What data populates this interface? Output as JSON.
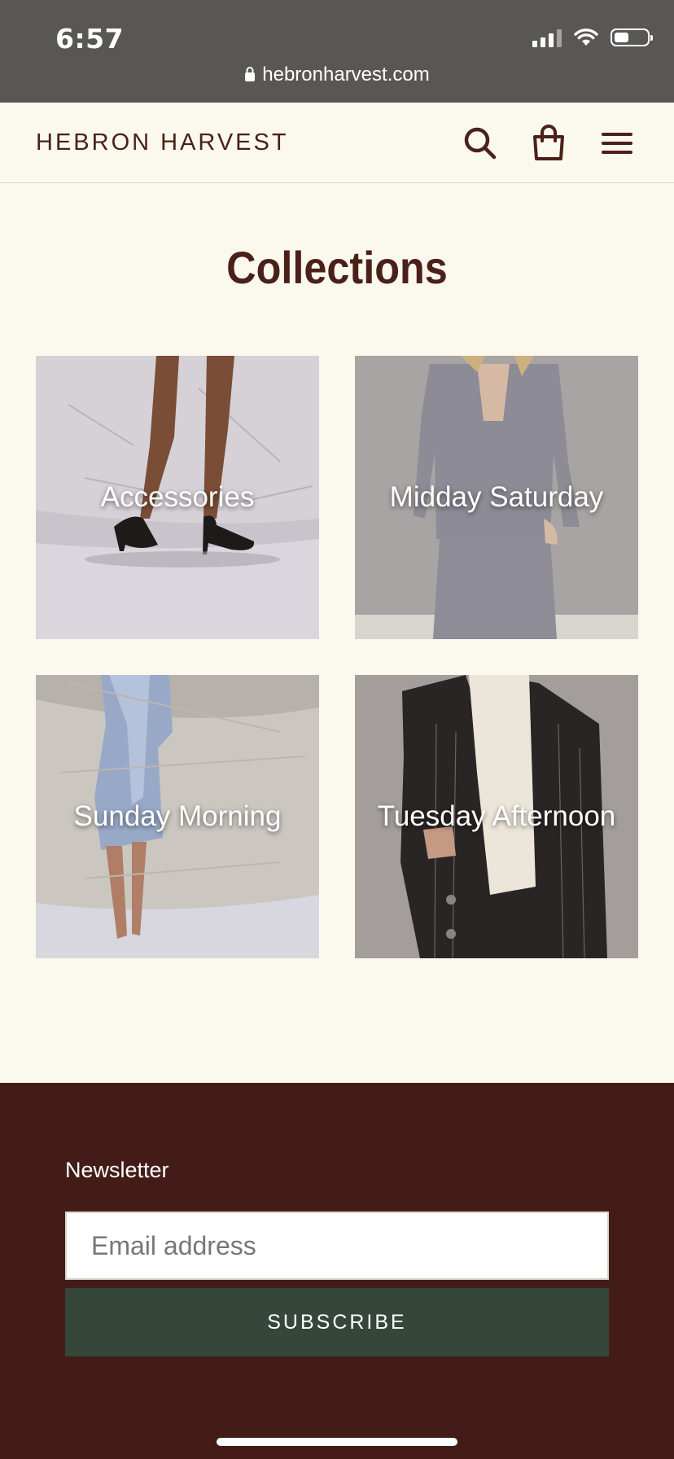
{
  "status_bar": {
    "time": "6:57",
    "url": "hebronharvest.com",
    "battery_level": 0.45
  },
  "header": {
    "brand": "HEBRON HARVEST",
    "icons": [
      "search-icon",
      "shopping-bag-icon",
      "menu-icon"
    ]
  },
  "main": {
    "title": "Collections",
    "collections": [
      {
        "label": "Accessories"
      },
      {
        "label": "Midday Saturday"
      },
      {
        "label": "Sunday Morning"
      },
      {
        "label": "Tuesday Afternoon"
      }
    ]
  },
  "footer": {
    "newsletter_heading": "Newsletter",
    "email_placeholder": "Email address",
    "subscribe_label": "SUBSCRIBE"
  },
  "colors": {
    "page_bg": "#fbf8ee",
    "brand_brown": "#4a2118",
    "footer_bg": "#431c18",
    "button_green": "#34473a",
    "status_bar_bg": "#595753"
  }
}
